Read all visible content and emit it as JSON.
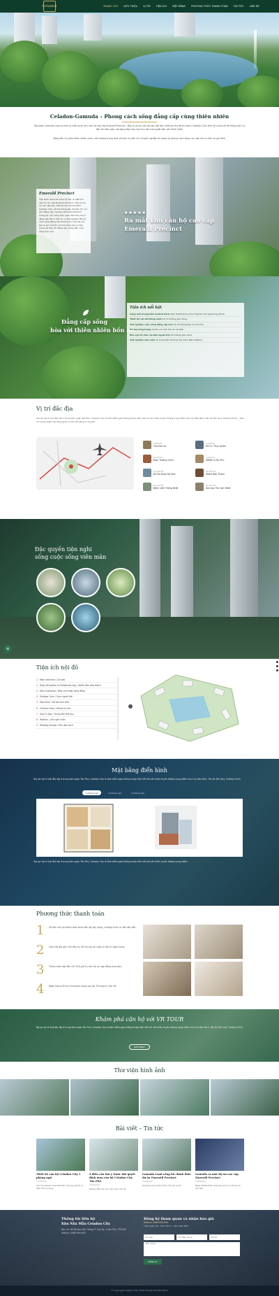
{
  "header": {
    "logo_text": "Celadon",
    "menu": [
      {
        "label": "TRANG CHỦ",
        "active": true
      },
      {
        "label": "GIỚI THIỆU",
        "active": false
      },
      {
        "label": "VỊ TRÍ",
        "active": false
      },
      {
        "label": "TIỆN ÍCH",
        "active": false
      },
      {
        "label": "MẶT BẰNG",
        "active": false
      },
      {
        "label": "PHƯƠNG THỨC THANH TOÁN",
        "active": false
      },
      {
        "label": "TIN TỨC",
        "active": false
      },
      {
        "label": "LIÊN HỆ",
        "active": false
      }
    ]
  },
  "intro": {
    "title": "Celadon-Gamuda – Phong cách sống đẳng cấp cùng thiên nhiên",
    "p1": "Tập đoàn Gamuda Land tự hào ra mắt dự án khu căn hộ cao cấp Emerald Precinct - Đây là dự án căn hộ cao cấp bậc nhất tại khu đô thị Xanh Celadon City. Sinh lời cùng với hệ thống dịch vụ tiện ích tiện nghi, đa dạng đáp ứng mọi nhu cầu mà người dân yêu thích nhất.",
    "p2": "Sống tiện ích giữa thiên nhiên xanh, môi trường trong lành và dịch vụ tiện ích chuyên nghiệp sẽ mang lại phong cách sống cao cấp cho cư dân và gia đình."
  },
  "emerald": {
    "panel_title": "Emerald Precinct",
    "panel_text": "Tập đoàn Gamuda Land tự hào ra mắt khu căn hộ cao cấp Emerald Precinct - Đây là dự án cao cấp bậc nhất tại khu đô thị Xanh Celadon City. Với hệ thống gần 20 tiện ích nội khu đẳng cấp. Celadon Emerald Precinct mang lại cuộc sống tiện nghi. Một khu nhà ở đẳng cấp để cư dân an cư lập nghiệp. Phong cách sống đẳng cấp thượng lưu hứa hẹn sẽ tạo ra sức hút lớn với mọi tầng lớp cư dân. Cùng với tiện ích đẳng cấp mang đến cuộc sống trọn vẹn.",
    "stars": "★★★★★",
    "caption_line1": "Ra mắt khu căn hộ cao cấp",
    "caption_line2": "Emerald Precinct"
  },
  "amenities": {
    "caption_line1": "Đẳng cấp sống",
    "caption_line2": "hòa với thiên nhiên bốn bề",
    "panel_title": "Tiện ích nổi bật",
    "rows": [
      {
        "bold": "Công viên trung tâm Central Park",
        "text": " được thiết kế như khu rừng thu nhỏ giữa lòng đô thị."
      },
      {
        "bold": "Thiết kế căn hộ thông minh",
        "text": " tối ưu không gian sống."
      },
      {
        "bold": "Trải nghiệm cuộc sống đẳng cấp hơn",
        "text": " với hệ thống tiện ích nội khu."
      },
      {
        "bold": "Hồ bơi sang trọng",
        "text": " và khu vui chơi trẻ em an toàn."
      },
      {
        "bold": "Khu vực tổ chức sự kiện ngoài trời",
        "text": " với không gian xanh."
      },
      {
        "bold": "Trải nghiệm mua sắm",
        "text": " tại Trung tâm thương mại Aeon Mall Celadon."
      }
    ]
  },
  "location": {
    "title": "Vị trí đắc địa",
    "description": "Toạ lạc tại trí tuệ đắc địa ở trung tâm quận Tân Phú, Celadon City là tâm điểm giao thông thuận tiện kết nối với nhiều tuyến đường trọng điểm như Lũy Bán Bích, Tân Kỳ Tân Quý, Trường Chinh... Tiện ích xung quanh đa dạng giúp cư dân dễ dàng di chuyển.",
    "pois": [
      {
        "time": "3 phút tới",
        "name": "Chợ Sơn Kỳ"
      },
      {
        "time": "5 phút tới",
        "name": "ĐH Cn Thực phẩm"
      },
      {
        "time": "5 phút tới",
        "name": "BigC Trường Chinh"
      },
      {
        "time": "7 phút tới",
        "name": "UBND Q.Tân Phú"
      },
      {
        "time": "10 phút tới",
        "name": "BV Đa Khoa Mỹ Đức"
      },
      {
        "time": "20 phút tới",
        "name": "Metro Bến Thành"
      },
      {
        "time": "25 phút tới",
        "name": "Bệnh viện Thống Nhất"
      },
      {
        "time": "25 phút tới",
        "name": "Sân bay Tân Sơn Nhất"
      }
    ]
  },
  "exclusive": {
    "title_line1": "Đặc quyền tiện nghi",
    "title_line2": "sống cuộc sống viên mãn"
  },
  "utilities": {
    "title": "Tiện ích nội đô",
    "items": [
      {
        "num": "1.",
        "text": "Main entrance / Lối vào"
      },
      {
        "num": "2.",
        "text": "Drop-off station to Pedestrian way / Điểm đón đưa khách"
      },
      {
        "num": "3.",
        "text": "Mini clubhouse / Nhà sinh hoạt cộng đồng"
      },
      {
        "num": "4.",
        "text": "Outdoor Gym / Gym ngoài trời"
      },
      {
        "num": "5.",
        "text": "Pool deck / Hồ bơi sinh thái"
      },
      {
        "num": "6.",
        "text": "Children Pool / Hồ bơi trẻ em"
      },
      {
        "num": "7.",
        "text": "Gym & Spa / Trung tâm thể dục"
      },
      {
        "num": "8.",
        "text": "Pavilion / Lều nghỉ chân"
      },
      {
        "num": "9.",
        "text": "Reading lounge / Khu đọc sách"
      }
    ]
  },
  "floorplan": {
    "title": "Mặt bằng điển hình",
    "desc1": "Toạ lạc tại trí tuệ đắc địa ở trung tâm quận Tân Phú, Celadon City là tâm điểm giao thông thuận tiện kết nối với nhiều tuyến đường trọng điểm như Lũy Bán Bích, Tân Kỳ Tân Quý, Trường Chinh.",
    "tabs": [
      {
        "label": "1 phòng ngủ",
        "active": true
      },
      {
        "label": "2 phòng ngủ",
        "active": false
      },
      {
        "label": "3 phòng ngủ",
        "active": false
      }
    ],
    "desc2": "Toạ lạc tại trí tuệ đắc địa ở trung tâm quận Tân Phú, Celadon City là tâm điểm giao thông thuận tiện kết nối với nhiều tuyến đường trọng điểm."
  },
  "payment": {
    "title": "Phương thức thanh toán",
    "steps": [
      {
        "num": "1",
        "text": "Số tiền còn lại thanh toán theo tiến độ xây dựng, chương trình ưu đãi hấp dẫn."
      },
      {
        "num": "2",
        "text": "Cam kết giá gốc chủ đầu tư, hỗ trợ vay lãi suất ưu đãi từ ngân hàng."
      },
      {
        "num": "3",
        "text": "Thanh toán đợt đầu chỉ 10% giá trị căn hộ, ký hợp đồng mua bán."
      },
      {
        "num": "4",
        "text": "Ngân hàng hỗ trợ cho khách hàng vay tới 70% giá trị căn hộ."
      }
    ]
  },
  "vr": {
    "title": "Khám phá căn hộ với VR TOUR",
    "desc": "Toạ lạc tại trí tuệ đắc địa ở trung tâm quận Tân Phú, Celadon City là tâm điểm giao thông thuận tiện kết nối với nhiều tuyến đường trọng điểm như Lũy Bán Bích, Tân Kỳ Tân Quý, Trường Chinh.",
    "button": "XEM NGAY"
  },
  "gallery": {
    "title": "Thư viện hình ảnh"
  },
  "news": {
    "title": "Bài viết – Tin tức",
    "items": [
      {
        "title": "Thiết kế căn hộ Celadon City 1 phòng ngủ",
        "date": "12/06/2019",
        "excerpt": "Căn hộ Celadon City thiết kế 1 phòng ngủ tối ưu diện tích sử dụng."
      },
      {
        "title": "4 điều cần lưu ý trước khi quyết định mua căn hộ Celadon City Tân Phú",
        "date": "12/06/2019",
        "excerpt": "Những điều cần lưu ý khi mua căn hộ."
      },
      {
        "title": "Gamuda Land công bố chính thức dự án Emerald Precinct",
        "date": "12/06/2019",
        "excerpt": "Gamuda Land chính thức công bố dự án."
      },
      {
        "title": "Gamuda ra mắt dự án cao cấp Emerald Precinct",
        "date": "12/06/2019",
        "excerpt": "Ngày 16/06/2019, Gamuda Land ra mắt dự án cao cấp."
      }
    ]
  },
  "footer": {
    "left_title": "Thông tin liên hệ",
    "left_subtitle": "Khu Nhà Mẫu Celadon City",
    "address": "Địa chỉ: 88 Bờ Bao Tân Thắng, P. Sơn Kỳ, Q.Tân Phú, TP.HCM",
    "phone": "Hotline: 0989.999.993",
    "right_title": "Đăng ký tham quan và nhận báo giá",
    "right_sub1": "Hotline: 0989.999.993",
    "right_sub2": "THỜI GIAN: 8H - 17H (THỨ 2 - CN) | NHÀ MẪU",
    "name_placeholder": "Họ tên",
    "phone_placeholder": "Số điện thoại",
    "email_placeholder": "Email",
    "msg_placeholder": "Nội dung",
    "submit": "ĐĂNG KÝ",
    "copyright": "© Copyright Celadon City. Thiết kế web bởi Web Team"
  }
}
